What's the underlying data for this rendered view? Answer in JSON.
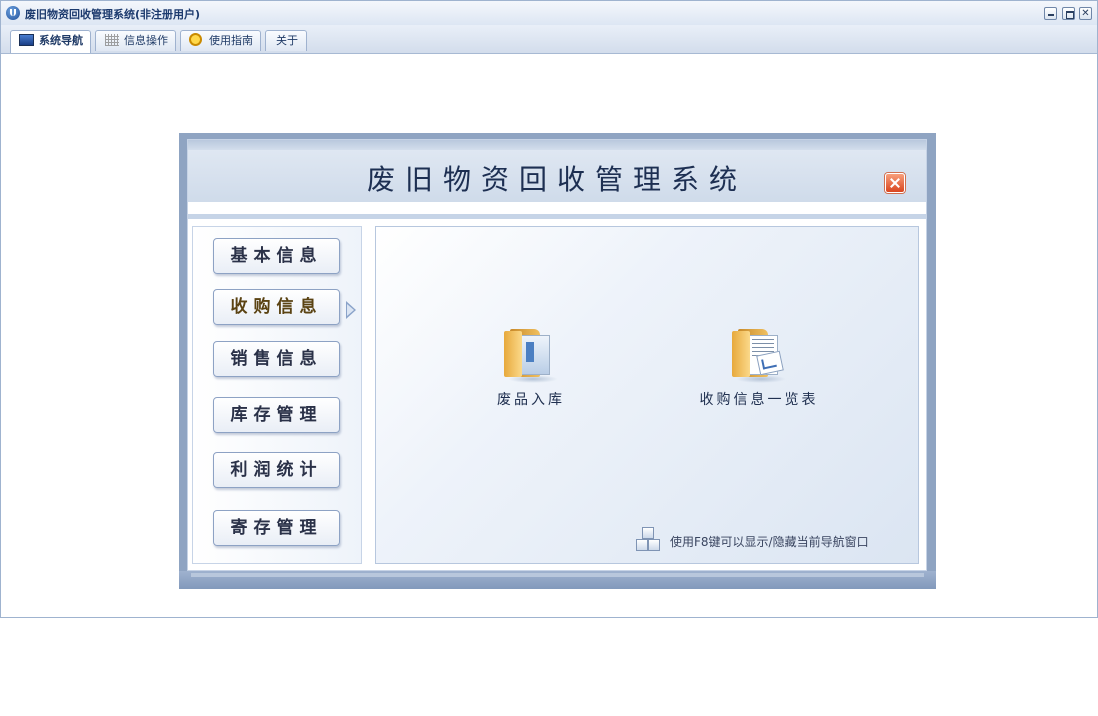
{
  "window": {
    "title": "废旧物资回收管理系统(非注册用户)"
  },
  "tabs": [
    {
      "label": "系统导航",
      "icon": "monitor-icon",
      "active": true
    },
    {
      "label": "信息操作",
      "icon": "grid-icon",
      "active": false
    },
    {
      "label": "使用指南",
      "icon": "help-icon",
      "active": false
    },
    {
      "label": "关于",
      "icon": "",
      "active": false
    }
  ],
  "nav": {
    "title": "废旧物资回收管理系统",
    "menu": [
      {
        "label": "基本信息",
        "active": false
      },
      {
        "label": "收购信息",
        "active": true
      },
      {
        "label": "销售信息",
        "active": false
      },
      {
        "label": "库存管理",
        "active": false
      },
      {
        "label": "利润统计",
        "active": false
      },
      {
        "label": "寄存管理",
        "active": false
      }
    ],
    "items": [
      {
        "label": "废品入库",
        "icon": "folder-window-icon"
      },
      {
        "label": "收购信息一览表",
        "icon": "folder-report-icon"
      }
    ],
    "hint": "使用F8键可以显示/隐藏当前导航窗口"
  },
  "colors": {
    "frame": "#8fa4c2",
    "title_text": "#1d2f52",
    "close_button": "#d9461f"
  }
}
